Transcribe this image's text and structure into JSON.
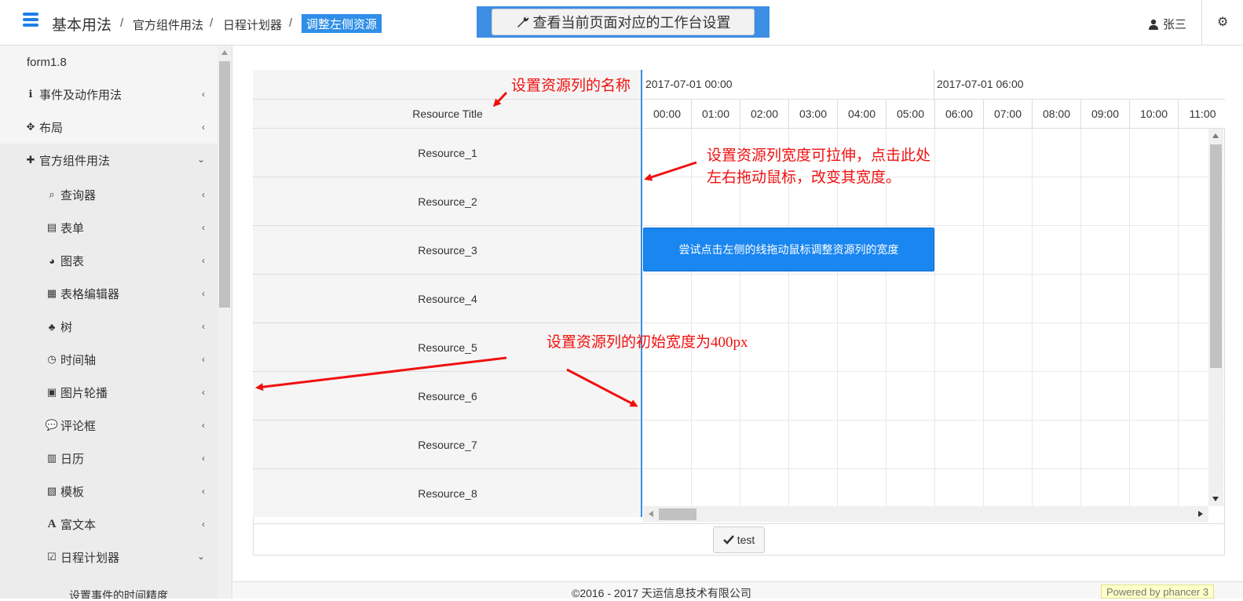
{
  "header": {
    "brand": "基本用法",
    "breadcrumbs": [
      "官方组件用法",
      "日程计划器"
    ],
    "separator": "/",
    "active_crumb": "调整左侧资源",
    "workbench_label": "查看当前页面对应的工作台设置",
    "user_name": "张三"
  },
  "sidebar": {
    "version": "form1.8",
    "items": [
      {
        "label": "事件及动作用法",
        "icon": "info-icon"
      },
      {
        "label": "布局",
        "icon": "move-icon"
      },
      {
        "label": "官方组件用法",
        "icon": "puzzle-icon"
      }
    ],
    "subitems": [
      {
        "label": "查询器",
        "icon": "search-icon"
      },
      {
        "label": "表单",
        "icon": "form-icon"
      },
      {
        "label": "图表",
        "icon": "pie-chart-icon"
      },
      {
        "label": "表格编辑器",
        "icon": "table-icon"
      },
      {
        "label": "树",
        "icon": "sitemap-icon"
      },
      {
        "label": "时间轴",
        "icon": "clock-icon"
      },
      {
        "label": "图片轮播",
        "icon": "image-icon"
      },
      {
        "label": "评论框",
        "icon": "comment-icon"
      },
      {
        "label": "日历",
        "icon": "calendar-icon"
      },
      {
        "label": "模板",
        "icon": "template-icon"
      },
      {
        "label": "富文本",
        "icon": "font-icon"
      },
      {
        "label": "日程计划器",
        "icon": "calendar-check-icon"
      }
    ],
    "cut_item": "设置事件的时间精度"
  },
  "scheduler": {
    "resource_title": "Resource Title",
    "resources": [
      "Resource_1",
      "Resource_2",
      "Resource_3",
      "Resource_4",
      "Resource_5",
      "Resource_6",
      "Resource_7",
      "Resource_8"
    ],
    "days": [
      "2017-07-01 00:00",
      "2017-07-01 06:00"
    ],
    "hours": [
      "00:00",
      "01:00",
      "02:00",
      "03:00",
      "04:00",
      "05:00",
      "06:00",
      "07:00",
      "08:00",
      "09:00",
      "10:00",
      "11:00"
    ],
    "event_text": "尝试点击左侧的线拖动鼠标调整资源列的宽度"
  },
  "test_button": "test",
  "footer": {
    "copyright": "©2016 - 2017 天运信息技术有限公司",
    "powered": "Powered by phancer 3"
  },
  "annotations": {
    "name": "设置资源列的名称",
    "resize_line1": "设置资源列宽度可拉伸，点击此处",
    "resize_line2": "左右拖动鼠标，改变其宽度。",
    "initial_width": "设置资源列的初始宽度为400px"
  },
  "colors": {
    "accent": "#2f8fe8",
    "event": "#1a86f0",
    "annotation": "#f01010"
  }
}
